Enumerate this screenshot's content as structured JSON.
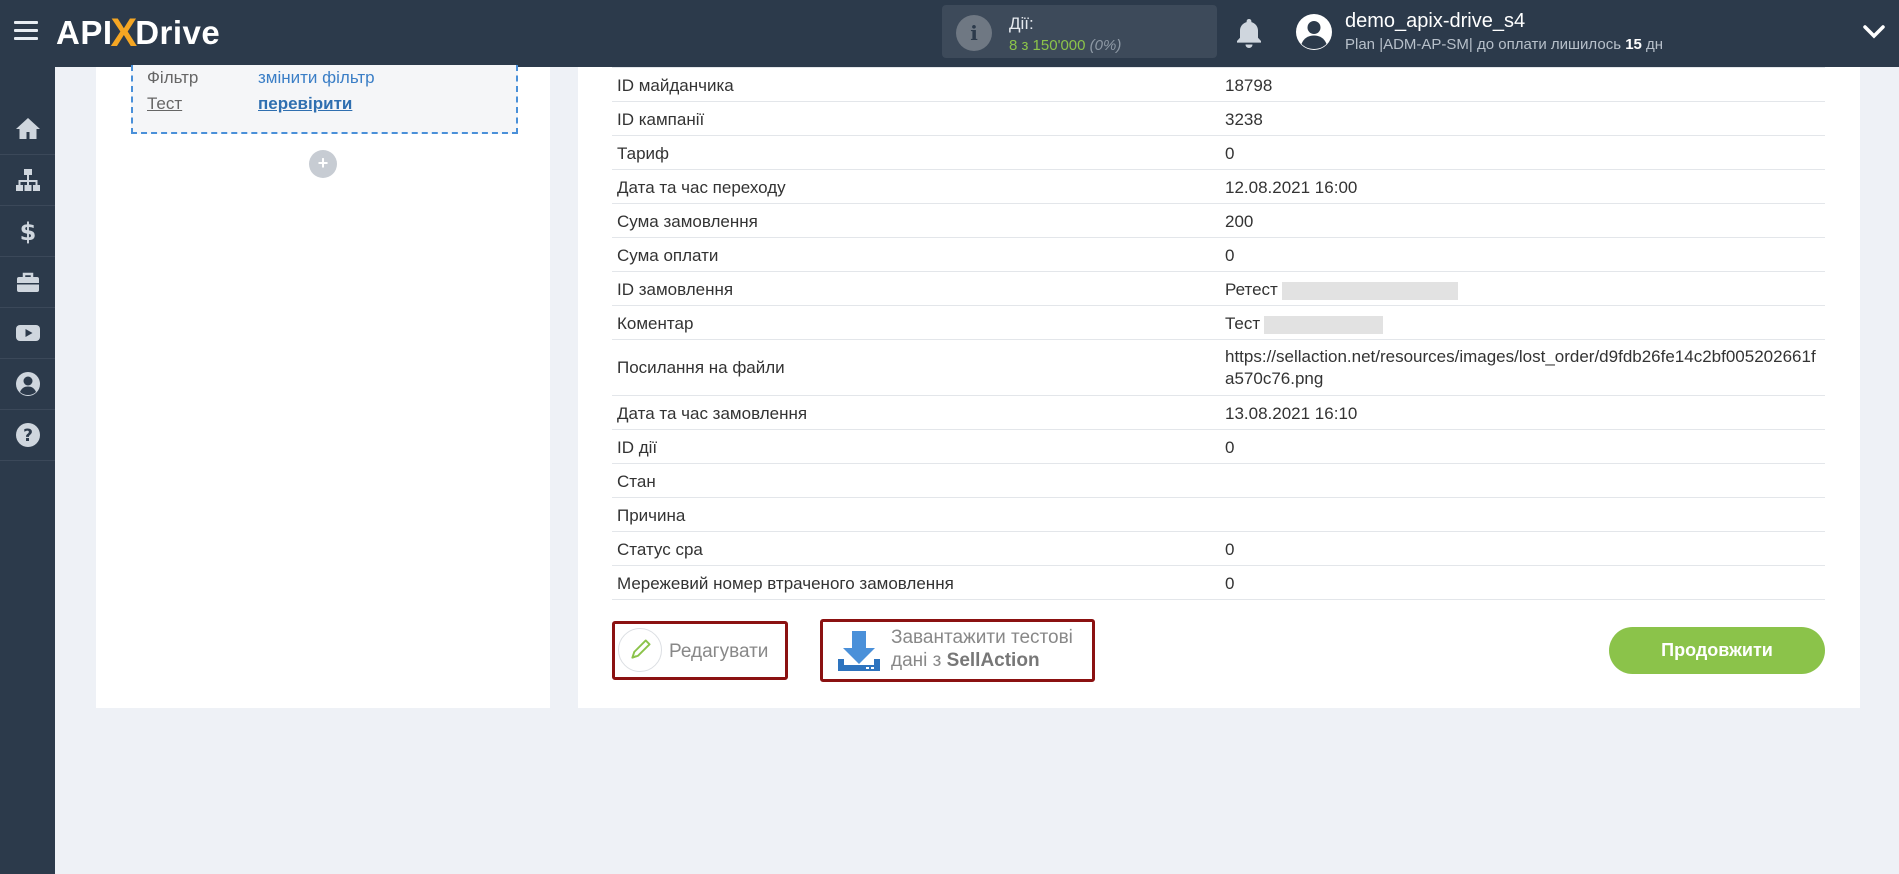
{
  "header": {
    "logo_prefix": "API",
    "logo_x": "X",
    "logo_suffix": "Drive",
    "actions_label": "Дії:",
    "actions_count": "8 з 150'000",
    "actions_percent": "(0%)",
    "user_name": "demo_apix-drive_s4",
    "plan_text": "Plan |ADM-AP-SM| до оплати лишилось",
    "plan_days": "15",
    "plan_unit": "дн"
  },
  "sidebar": {
    "items": [
      "home-icon",
      "sitemap-icon",
      "dollar-icon",
      "briefcase-icon",
      "youtube-icon",
      "user-icon",
      "help-icon"
    ]
  },
  "left_panel": {
    "filter_key": "Фільтр",
    "filter_value": "змінити фільтр",
    "test_key": "Тест",
    "test_value": "перевірити",
    "add_label": "+"
  },
  "table": {
    "rows": [
      {
        "key": "ID майданчика",
        "value": "18798"
      },
      {
        "key": "ID кампанії",
        "value": "3238"
      },
      {
        "key": "Тариф",
        "value": "0"
      },
      {
        "key": "Дата та час переходу",
        "value": "12.08.2021 16:00"
      },
      {
        "key": "Сума замовлення",
        "value": "200"
      },
      {
        "key": "Сума оплати",
        "value": "0"
      },
      {
        "key": "ID замовлення",
        "value": "Ретест"
      },
      {
        "key": "Коментар",
        "value": "Тест"
      },
      {
        "key": "Посилання на файли",
        "value": "https://sellaction.net/resources/images/lost_order/d9fdb26fe14c2bf005202661fa570c76.png"
      },
      {
        "key": "Дата та час замовлення",
        "value": "13.08.2021 16:10"
      },
      {
        "key": "ID дії",
        "value": "0"
      },
      {
        "key": "Стан",
        "value": ""
      },
      {
        "key": "Причина",
        "value": ""
      },
      {
        "key": "Статус cpa",
        "value": "0"
      },
      {
        "key": "Мережевий номер втраченого замовлення",
        "value": "0"
      }
    ]
  },
  "buttons": {
    "edit_label": "Редагувати",
    "load_line1": "Завантажити тестові",
    "load_line2_prefix": "дані з",
    "load_line2_bold": "SellAction",
    "continue_label": "Продовжити"
  },
  "colors": {
    "topbar": "#2c3a4b",
    "accent_green": "#8bc34a",
    "logo_orange": "#f5a623",
    "highlight_border": "#8b1111",
    "link_blue": "#3a7ec6"
  }
}
